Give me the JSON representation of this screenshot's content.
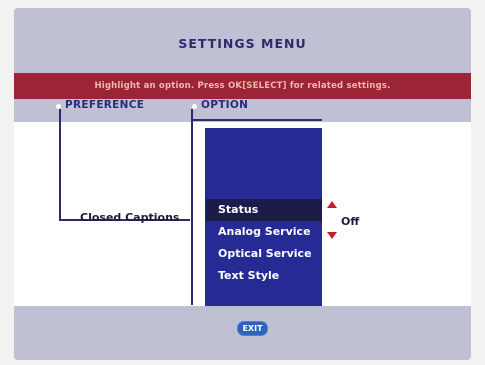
{
  "menu": {
    "title": "SETTINGS MENU",
    "hint": "Highlight an option. Press OK[SELECT] for related settings.",
    "preference_header": "PREFERENCE",
    "option_header": "OPTION",
    "preference_item": "Closed Captions",
    "options": [
      {
        "label": "Status",
        "selected": true
      },
      {
        "label": "Analog Service",
        "selected": false
      },
      {
        "label": "Optical Service",
        "selected": false
      },
      {
        "label": "Text Style",
        "selected": false
      }
    ],
    "current_value": "Off",
    "exit_label": "EXIT"
  },
  "colors": {
    "background": "#bfc0d3",
    "hint_bar": "#9b2536",
    "option_panel": "#262a95",
    "selected_row": "#1b1c4a",
    "exit_button": "#2d63bd",
    "arrows": "#c41d2a"
  }
}
